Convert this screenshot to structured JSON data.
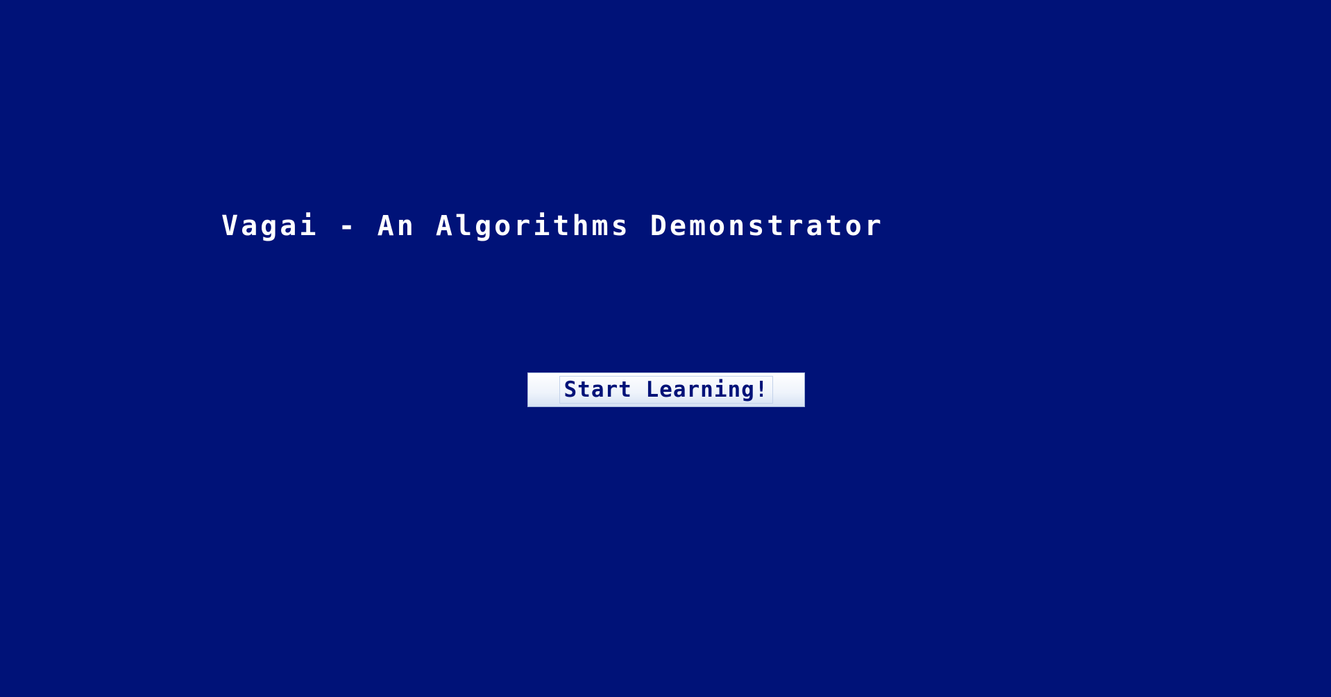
{
  "page": {
    "background_color": "#001278",
    "title": "Vagai - An Algorithms Demonstrator"
  },
  "start_button": {
    "label": "Start Learning!",
    "text_color": "#001278"
  }
}
